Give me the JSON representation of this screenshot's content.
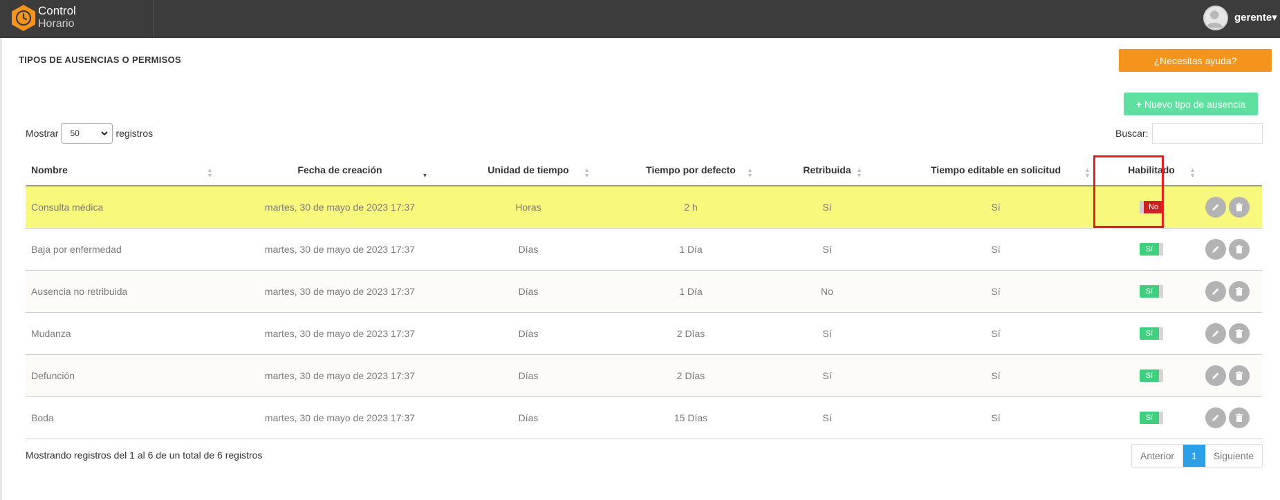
{
  "brand": {
    "line1": "Control",
    "line2": "Horario"
  },
  "header": {
    "user": "gerente",
    "caret": "▾"
  },
  "page": {
    "title": "TIPOS DE AUSENCIAS O PERMISOS",
    "help_label": "¿Necesitas ayuda?",
    "new_label": "Nuevo tipo de ausencia"
  },
  "controls": {
    "show_prefix": "Mostrar",
    "show_value": "50",
    "show_suffix": "registros",
    "search_label": "Buscar:",
    "search_value": ""
  },
  "table": {
    "columns": [
      "Nombre",
      "Fecha de creación",
      "Unidad de tiempo",
      "Tiempo por defecto",
      "Retribuida",
      "Tiempo editable en solicitud",
      "Habilitado"
    ],
    "rows": [
      {
        "name": "Consulta médica",
        "date": "martes, 30 de mayo de 2023 17:37",
        "unit": "Horas",
        "default_time": "2 h",
        "paid": "Sí",
        "editable": "Sí",
        "enabled": "No"
      },
      {
        "name": "Baja por enfermedad",
        "date": "martes, 30 de mayo de 2023 17:37",
        "unit": "Días",
        "default_time": "1 Día",
        "paid": "Sí",
        "editable": "Sí",
        "enabled": "Sí"
      },
      {
        "name": "Ausencia no retribuida",
        "date": "martes, 30 de mayo de 2023 17:37",
        "unit": "Días",
        "default_time": "1 Día",
        "paid": "No",
        "editable": "Sí",
        "enabled": "Sí"
      },
      {
        "name": "Mudanza",
        "date": "martes, 30 de mayo de 2023 17:37",
        "unit": "Días",
        "default_time": "2 Días",
        "paid": "Sí",
        "editable": "Sí",
        "enabled": "Sí"
      },
      {
        "name": "Defunción",
        "date": "martes, 30 de mayo de 2023 17:37",
        "unit": "Días",
        "default_time": "2 Días",
        "paid": "Sí",
        "editable": "Sí",
        "enabled": "Sí"
      },
      {
        "name": "Boda",
        "date": "martes, 30 de mayo de 2023 17:37",
        "unit": "Días",
        "default_time": "15 Días",
        "paid": "Sí",
        "editable": "Sí",
        "enabled": "Sí"
      }
    ]
  },
  "footer": {
    "info": "Mostrando registros del 1 al 6 de un total de 6 registros",
    "prev": "Anterior",
    "current": "1",
    "next": "Siguiente"
  },
  "colors": {
    "accent_orange": "#f5941d",
    "accent_green": "#5ee1a0",
    "disabled_red": "#cc2222",
    "highlight_yellow": "#f8f87c",
    "annotation_red": "#e41f1f"
  }
}
